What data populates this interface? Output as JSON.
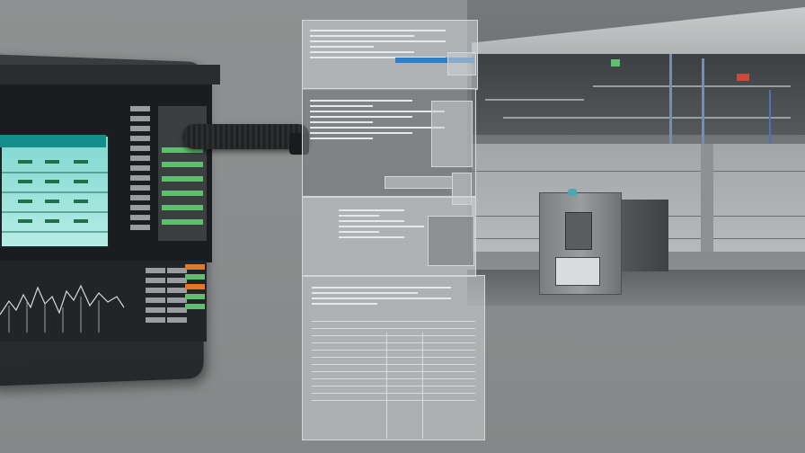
{
  "scene": {
    "accent_teal": "#138e8a",
    "screen_teal": "#7fd8d0",
    "indicator_green": "#5fbf6f",
    "indicator_orange": "#e07a2a",
    "pipe_blue": "#6f8fc0"
  },
  "icons": {
    "cable": "cable-icon",
    "monitor": "monitor-icon",
    "cabinet": "equipment-cabinet-icon"
  }
}
